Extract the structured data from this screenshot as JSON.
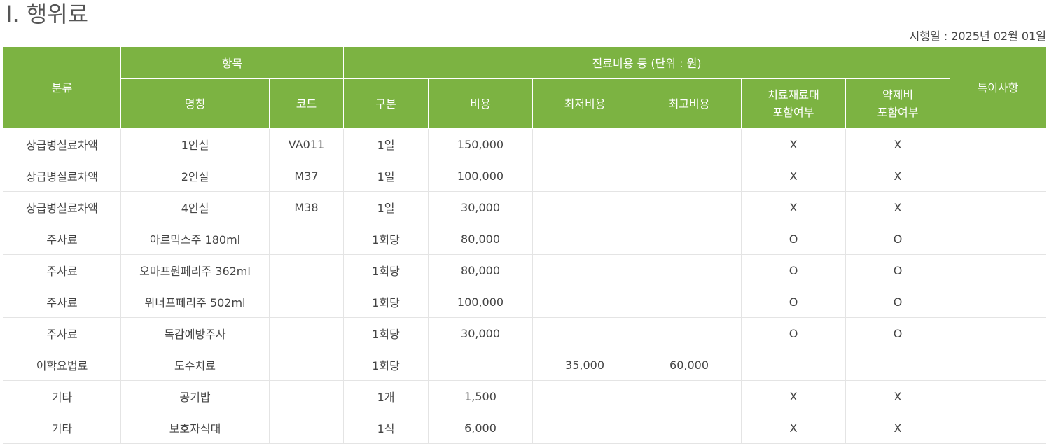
{
  "page": {
    "title": "Ⅰ. 행위료",
    "effective_date": "시행일 : 2025년 02월 01일"
  },
  "table": {
    "header": {
      "category": "분류",
      "item_group": "항목",
      "cost_group": "진료비용 등 (단위 : 원)",
      "notes": "특이사항",
      "name": "명칭",
      "code": "코드",
      "unit": "구분",
      "cost": "비용",
      "min_cost": "최저비용",
      "max_cost": "최고비용",
      "material_line1": "치료재료대",
      "material_line2": "포함여부",
      "drug_line1": "약제비",
      "drug_line2": "포함여부"
    },
    "rows": [
      {
        "category": "상급병실료차액",
        "name": "1인실",
        "code": "VA011",
        "unit": "1일",
        "cost": "150,000",
        "min_cost": "",
        "max_cost": "",
        "material": "X",
        "drug": "X",
        "notes": ""
      },
      {
        "category": "상급병실료차액",
        "name": "2인실",
        "code": "M37",
        "unit": "1일",
        "cost": "100,000",
        "min_cost": "",
        "max_cost": "",
        "material": "X",
        "drug": "X",
        "notes": ""
      },
      {
        "category": "상급병실료차액",
        "name": "4인실",
        "code": "M38",
        "unit": "1일",
        "cost": "30,000",
        "min_cost": "",
        "max_cost": "",
        "material": "X",
        "drug": "X",
        "notes": ""
      },
      {
        "category": "주사료",
        "name": "아르믹스주 180ml",
        "code": "",
        "unit": "1회당",
        "cost": "80,000",
        "min_cost": "",
        "max_cost": "",
        "material": "O",
        "drug": "O",
        "notes": ""
      },
      {
        "category": "주사료",
        "name": "오마프원페리주 362ml",
        "code": "",
        "unit": "1회당",
        "cost": "80,000",
        "min_cost": "",
        "max_cost": "",
        "material": "O",
        "drug": "O",
        "notes": ""
      },
      {
        "category": "주사료",
        "name": "위너프페리주 502ml",
        "code": "",
        "unit": "1회당",
        "cost": "100,000",
        "min_cost": "",
        "max_cost": "",
        "material": "O",
        "drug": "O",
        "notes": ""
      },
      {
        "category": "주사료",
        "name": "독감예방주사",
        "code": "",
        "unit": "1회당",
        "cost": "30,000",
        "min_cost": "",
        "max_cost": "",
        "material": "O",
        "drug": "O",
        "notes": ""
      },
      {
        "category": "이학요법료",
        "name": "도수치료",
        "code": "",
        "unit": "1회당",
        "cost": "",
        "min_cost": "35,000",
        "max_cost": "60,000",
        "material": "",
        "drug": "",
        "notes": ""
      },
      {
        "category": "기타",
        "name": "공기밥",
        "code": "",
        "unit": "1개",
        "cost": "1,500",
        "min_cost": "",
        "max_cost": "",
        "material": "X",
        "drug": "X",
        "notes": ""
      },
      {
        "category": "기타",
        "name": "보호자식대",
        "code": "",
        "unit": "1식",
        "cost": "6,000",
        "min_cost": "",
        "max_cost": "",
        "material": "X",
        "drug": "X",
        "notes": ""
      }
    ]
  }
}
